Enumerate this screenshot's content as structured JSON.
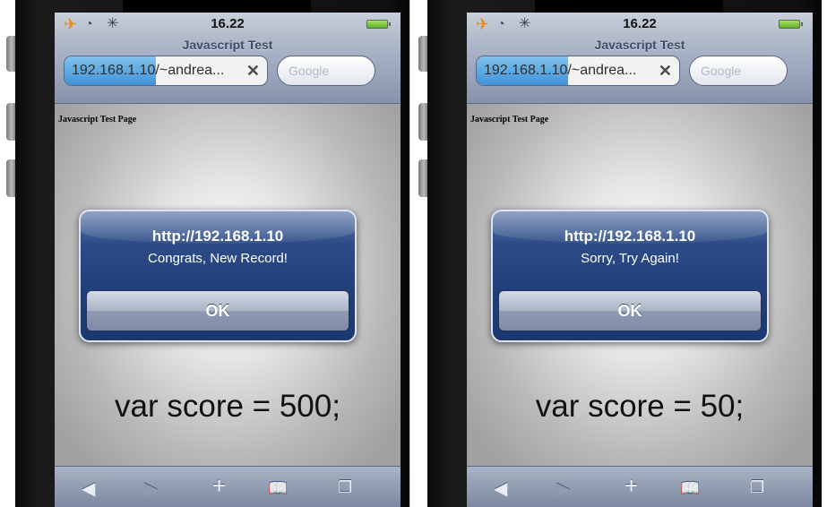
{
  "phones": [
    {
      "status": {
        "time": "16.22"
      },
      "browser": {
        "title": "Javascript Test",
        "url": "192.168.1.10/~andrea...",
        "search_placeholder": "Google",
        "load_progress": 0.45
      },
      "page": {
        "heading": "Javascript Test Page",
        "code_text": "var score = 500;"
      },
      "alert": {
        "title": "http://192.168.1.10",
        "message": "Congrats, New Record!",
        "ok_label": "OK"
      }
    },
    {
      "status": {
        "time": "16.22"
      },
      "browser": {
        "title": "Javascript Test",
        "url": "192.168.1.10/~andrea...",
        "search_placeholder": "Google",
        "load_progress": 0.45
      },
      "page": {
        "heading": "Javascript Test Page",
        "code_text": "var score = 50;"
      },
      "alert": {
        "title": "http://192.168.1.10",
        "message": "Sorry, Try Again!",
        "ok_label": "OK"
      }
    }
  ],
  "icons": {
    "airplane": "airplane-icon",
    "wifi": "wifi-icon",
    "activity": "activity-spinner-icon",
    "battery": "battery-icon",
    "clear": "clear-x-icon",
    "back": "back-arrow-icon",
    "forward": "forward-arrow-icon",
    "add": "plus-icon",
    "bookmarks": "bookmarks-book-icon",
    "pages": "pages-icon"
  },
  "colors": {
    "alert_blue": "#213f79",
    "progress_blue": "#3c8fd6",
    "navbar": "#8793ab"
  }
}
